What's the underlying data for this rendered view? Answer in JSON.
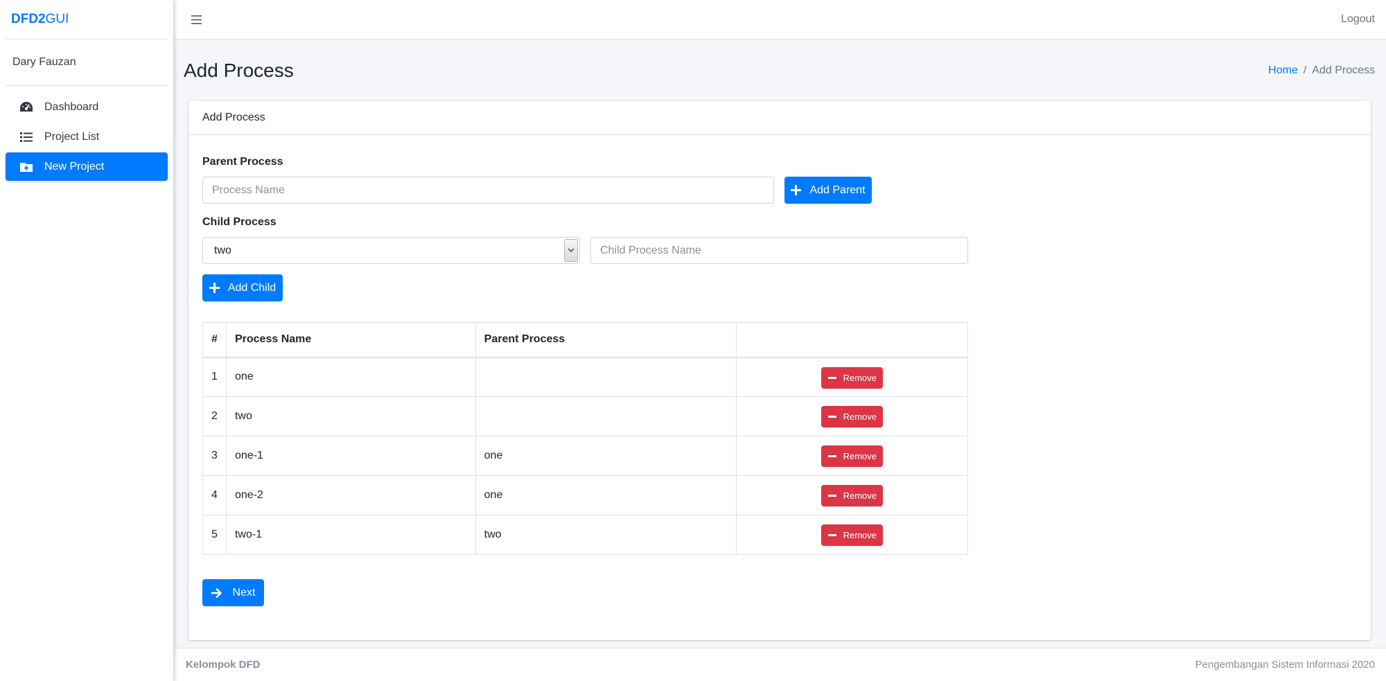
{
  "brand": {
    "bold": "DFD2",
    "light": "GUI"
  },
  "user": {
    "name": "Dary Fauzan"
  },
  "sidebar": {
    "items": [
      {
        "label": "Dashboard",
        "icon": "tachometer-icon"
      },
      {
        "label": "Project List",
        "icon": "list-icon"
      },
      {
        "label": "New Project",
        "icon": "folder-plus-icon",
        "active": true
      }
    ]
  },
  "topbar": {
    "logout": "Logout"
  },
  "page": {
    "title": "Add Process",
    "breadcrumb": {
      "home": "Home",
      "sep": "/",
      "current": "Add Process"
    }
  },
  "card": {
    "title": "Add Process",
    "parent": {
      "label": "Parent Process",
      "placeholder": "Process Name",
      "button": "Add Parent"
    },
    "child": {
      "label": "Child Process",
      "selected": "two",
      "placeholder": "Child Process Name",
      "button": "Add Child"
    },
    "table": {
      "headers": [
        "#",
        "Process Name",
        "Parent Process",
        ""
      ],
      "rows": [
        {
          "num": "1",
          "name": "one",
          "parent": "",
          "action": "Remove"
        },
        {
          "num": "2",
          "name": "two",
          "parent": "",
          "action": "Remove"
        },
        {
          "num": "3",
          "name": "one-1",
          "parent": "one",
          "action": "Remove"
        },
        {
          "num": "4",
          "name": "one-2",
          "parent": "one",
          "action": "Remove"
        },
        {
          "num": "5",
          "name": "two-1",
          "parent": "two",
          "action": "Remove"
        }
      ]
    },
    "next_button": "Next"
  },
  "footer": {
    "left": "Kelompok DFD",
    "right": "Pengembangan Sistem Informasi 2020"
  },
  "colors": {
    "primary": "#007bff",
    "danger": "#dc3545",
    "background": "#f4f6f9"
  }
}
